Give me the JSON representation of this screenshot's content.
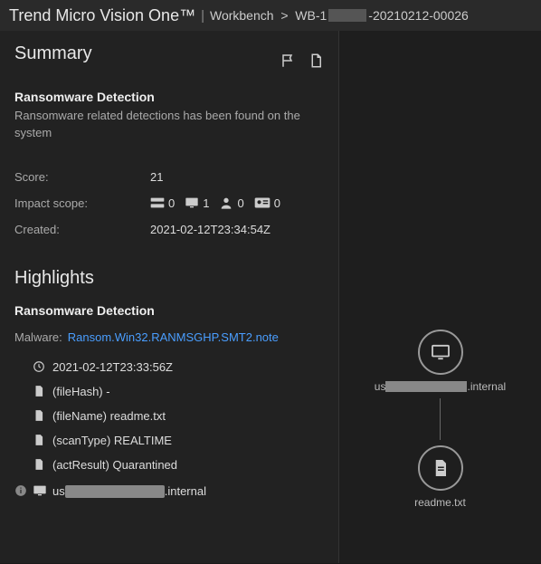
{
  "header": {
    "app_name": "Trend Micro Vision One™",
    "crumb_root": "Workbench",
    "alert_prefix": "WB-1",
    "alert_suffix": "-20210212-00026"
  },
  "summary": {
    "title": "Summary",
    "detection_title": "Ransomware Detection",
    "detection_desc": "Ransomware related detections has been found on the system",
    "score_label": "Score:",
    "score_value": "21",
    "impact_label": "Impact scope:",
    "impact": {
      "servers": "0",
      "desktops": "1",
      "users": "0",
      "accounts": "0"
    },
    "created_label": "Created:",
    "created_value": "2021-02-12T23:34:54Z"
  },
  "highlights": {
    "title": "Highlights",
    "detection_title": "Ransomware Detection",
    "malware_label": "Malware:",
    "malware_link": "Ransom.Win32.RANMSGHP.SMT2.note",
    "items": [
      {
        "icon": "clock",
        "text": "2021-02-12T23:33:56Z"
      },
      {
        "icon": "file",
        "text": "(fileHash)  -"
      },
      {
        "icon": "file",
        "text": "(fileName)  readme.txt"
      },
      {
        "icon": "file",
        "text": "(scanType)  REALTIME"
      },
      {
        "icon": "file",
        "text": "(actResult)  Quarantined"
      }
    ],
    "endpoint_prefix": "us",
    "endpoint_suffix": ".internal"
  },
  "graph": {
    "node1_prefix": "us",
    "node1_suffix": ".internal",
    "node2_label": "readme.txt"
  }
}
